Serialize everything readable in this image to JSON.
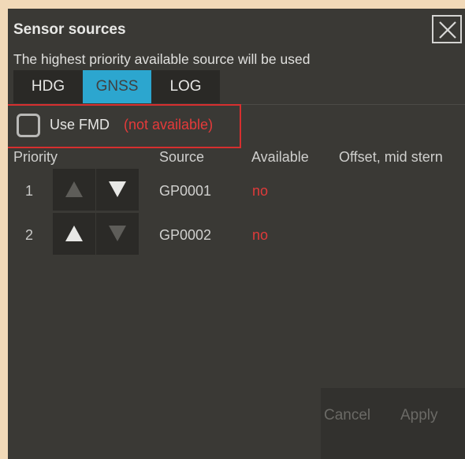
{
  "dialog": {
    "title": "Sensor sources",
    "subtitle": "The highest priority available source will be used",
    "close_icon": "close-icon"
  },
  "tabs": [
    {
      "label": "HDG",
      "active": false
    },
    {
      "label": "GNSS",
      "active": true
    },
    {
      "label": "LOG",
      "active": false
    }
  ],
  "fmd": {
    "label": "Use FMD",
    "status": "(not available)",
    "checked": false
  },
  "table": {
    "headers": [
      "Priority",
      "Source",
      "Available",
      "Offset, mid stern"
    ],
    "rows": [
      {
        "priority": "1",
        "source": "GP0001",
        "available": "no",
        "up_enabled": false,
        "down_enabled": true
      },
      {
        "priority": "2",
        "source": "GP0002",
        "available": "no",
        "up_enabled": true,
        "down_enabled": false
      }
    ]
  },
  "footer": {
    "cancel_label": "Cancel",
    "apply_label": "Apply"
  },
  "colors": {
    "background": "#3a3935",
    "accent_tab": "#2ca6cf",
    "warning": "#e53a3a",
    "highlight_border": "#d62f2f"
  }
}
